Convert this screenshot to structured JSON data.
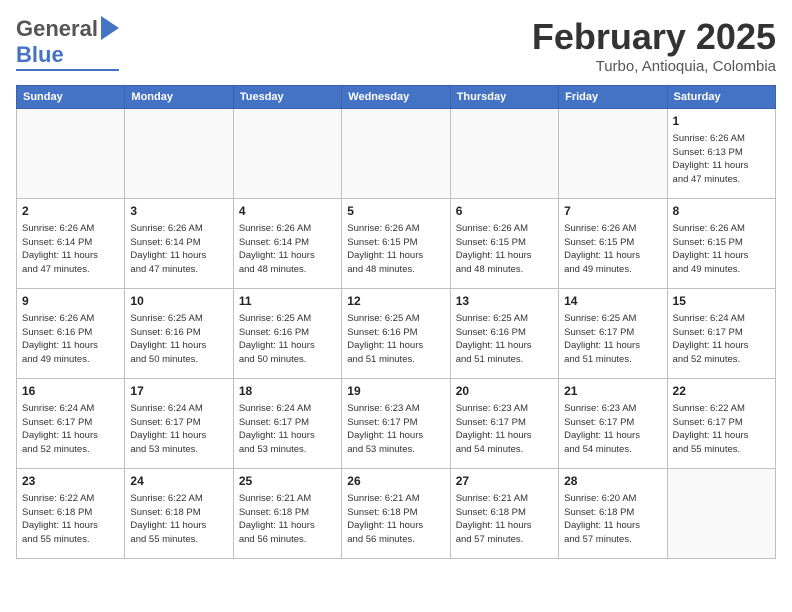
{
  "header": {
    "logo_line1": "General",
    "logo_line2": "Blue",
    "month": "February 2025",
    "location": "Turbo, Antioquia, Colombia"
  },
  "weekdays": [
    "Sunday",
    "Monday",
    "Tuesday",
    "Wednesday",
    "Thursday",
    "Friday",
    "Saturday"
  ],
  "weeks": [
    [
      {
        "day": "",
        "info": ""
      },
      {
        "day": "",
        "info": ""
      },
      {
        "day": "",
        "info": ""
      },
      {
        "day": "",
        "info": ""
      },
      {
        "day": "",
        "info": ""
      },
      {
        "day": "",
        "info": ""
      },
      {
        "day": "1",
        "info": "Sunrise: 6:26 AM\nSunset: 6:13 PM\nDaylight: 11 hours\nand 47 minutes."
      }
    ],
    [
      {
        "day": "2",
        "info": "Sunrise: 6:26 AM\nSunset: 6:14 PM\nDaylight: 11 hours\nand 47 minutes."
      },
      {
        "day": "3",
        "info": "Sunrise: 6:26 AM\nSunset: 6:14 PM\nDaylight: 11 hours\nand 47 minutes."
      },
      {
        "day": "4",
        "info": "Sunrise: 6:26 AM\nSunset: 6:14 PM\nDaylight: 11 hours\nand 48 minutes."
      },
      {
        "day": "5",
        "info": "Sunrise: 6:26 AM\nSunset: 6:15 PM\nDaylight: 11 hours\nand 48 minutes."
      },
      {
        "day": "6",
        "info": "Sunrise: 6:26 AM\nSunset: 6:15 PM\nDaylight: 11 hours\nand 48 minutes."
      },
      {
        "day": "7",
        "info": "Sunrise: 6:26 AM\nSunset: 6:15 PM\nDaylight: 11 hours\nand 49 minutes."
      },
      {
        "day": "8",
        "info": "Sunrise: 6:26 AM\nSunset: 6:15 PM\nDaylight: 11 hours\nand 49 minutes."
      }
    ],
    [
      {
        "day": "9",
        "info": "Sunrise: 6:26 AM\nSunset: 6:16 PM\nDaylight: 11 hours\nand 49 minutes."
      },
      {
        "day": "10",
        "info": "Sunrise: 6:25 AM\nSunset: 6:16 PM\nDaylight: 11 hours\nand 50 minutes."
      },
      {
        "day": "11",
        "info": "Sunrise: 6:25 AM\nSunset: 6:16 PM\nDaylight: 11 hours\nand 50 minutes."
      },
      {
        "day": "12",
        "info": "Sunrise: 6:25 AM\nSunset: 6:16 PM\nDaylight: 11 hours\nand 51 minutes."
      },
      {
        "day": "13",
        "info": "Sunrise: 6:25 AM\nSunset: 6:16 PM\nDaylight: 11 hours\nand 51 minutes."
      },
      {
        "day": "14",
        "info": "Sunrise: 6:25 AM\nSunset: 6:17 PM\nDaylight: 11 hours\nand 51 minutes."
      },
      {
        "day": "15",
        "info": "Sunrise: 6:24 AM\nSunset: 6:17 PM\nDaylight: 11 hours\nand 52 minutes."
      }
    ],
    [
      {
        "day": "16",
        "info": "Sunrise: 6:24 AM\nSunset: 6:17 PM\nDaylight: 11 hours\nand 52 minutes."
      },
      {
        "day": "17",
        "info": "Sunrise: 6:24 AM\nSunset: 6:17 PM\nDaylight: 11 hours\nand 53 minutes."
      },
      {
        "day": "18",
        "info": "Sunrise: 6:24 AM\nSunset: 6:17 PM\nDaylight: 11 hours\nand 53 minutes."
      },
      {
        "day": "19",
        "info": "Sunrise: 6:23 AM\nSunset: 6:17 PM\nDaylight: 11 hours\nand 53 minutes."
      },
      {
        "day": "20",
        "info": "Sunrise: 6:23 AM\nSunset: 6:17 PM\nDaylight: 11 hours\nand 54 minutes."
      },
      {
        "day": "21",
        "info": "Sunrise: 6:23 AM\nSunset: 6:17 PM\nDaylight: 11 hours\nand 54 minutes."
      },
      {
        "day": "22",
        "info": "Sunrise: 6:22 AM\nSunset: 6:17 PM\nDaylight: 11 hours\nand 55 minutes."
      }
    ],
    [
      {
        "day": "23",
        "info": "Sunrise: 6:22 AM\nSunset: 6:18 PM\nDaylight: 11 hours\nand 55 minutes."
      },
      {
        "day": "24",
        "info": "Sunrise: 6:22 AM\nSunset: 6:18 PM\nDaylight: 11 hours\nand 55 minutes."
      },
      {
        "day": "25",
        "info": "Sunrise: 6:21 AM\nSunset: 6:18 PM\nDaylight: 11 hours\nand 56 minutes."
      },
      {
        "day": "26",
        "info": "Sunrise: 6:21 AM\nSunset: 6:18 PM\nDaylight: 11 hours\nand 56 minutes."
      },
      {
        "day": "27",
        "info": "Sunrise: 6:21 AM\nSunset: 6:18 PM\nDaylight: 11 hours\nand 57 minutes."
      },
      {
        "day": "28",
        "info": "Sunrise: 6:20 AM\nSunset: 6:18 PM\nDaylight: 11 hours\nand 57 minutes."
      },
      {
        "day": "",
        "info": ""
      }
    ]
  ]
}
